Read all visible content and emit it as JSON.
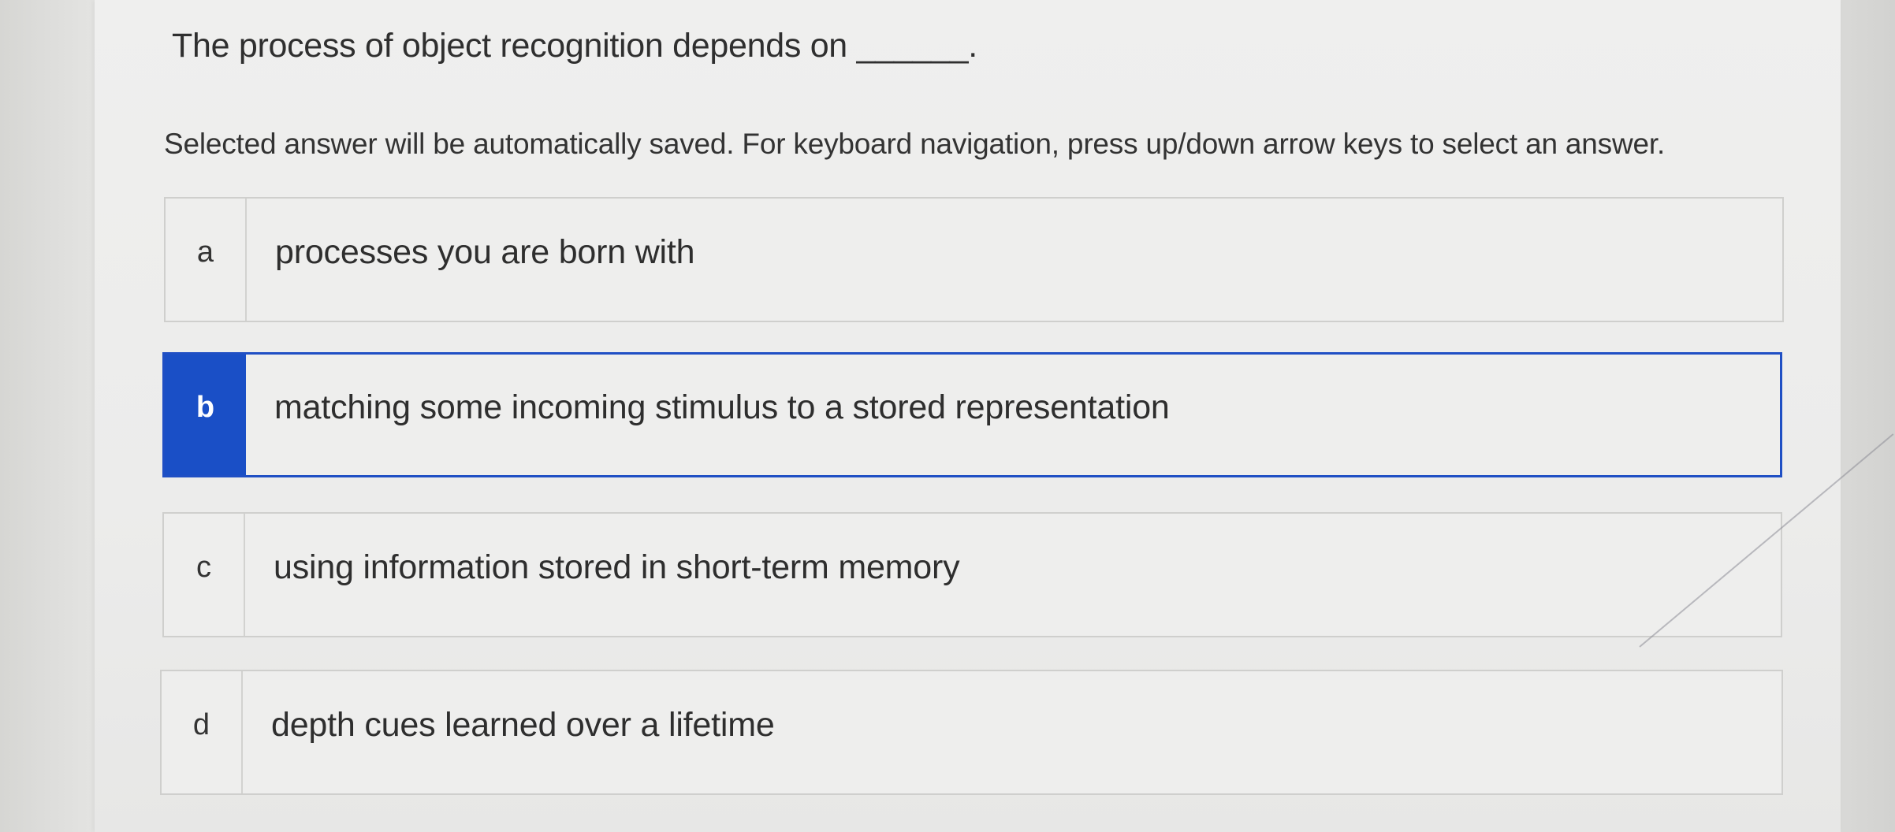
{
  "question": {
    "text": "The process of object recognition depends on ______."
  },
  "instructions": "Selected answer will be automatically saved. For keyboard navigation, press up/down arrow keys to select an answer.",
  "options": [
    {
      "letter": "a",
      "text": "processes you are born with",
      "selected": false
    },
    {
      "letter": "b",
      "text": "matching some incoming stimulus to a stored representation",
      "selected": true
    },
    {
      "letter": "c",
      "text": "using information stored in short-term memory",
      "selected": false
    },
    {
      "letter": "d",
      "text": "depth cues learned over a lifetime",
      "selected": false
    }
  ],
  "colors": {
    "accent": "#1a4fc6",
    "border": "#cfcfcd",
    "background": "#eeeeed"
  }
}
